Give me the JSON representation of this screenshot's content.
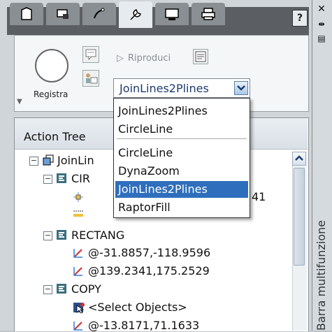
{
  "sidebar": {
    "close_icon": "close-icon",
    "pin_icon": "pin-icon",
    "menu_icon": "menu-icon",
    "vertical_title": "Barra multifunzione"
  },
  "tabs": [
    {
      "icon": "home-icon"
    },
    {
      "icon": "insert-icon"
    },
    {
      "icon": "annotate-icon"
    },
    {
      "icon": "tools-icon",
      "active": true
    },
    {
      "icon": "view-icon"
    },
    {
      "icon": "print-icon"
    }
  ],
  "help_label": "?",
  "ribbon": {
    "record_label": "Registra",
    "play_label": "Riproduci",
    "macro_combo_value": "JoinLines2Plines"
  },
  "dropdown": {
    "items": [
      "JoinLines2Plines",
      "CircleLine",
      "CircleLine",
      "DynaZoom",
      "JoinLines2Plines",
      "RaptorFill"
    ],
    "selected_index": 4
  },
  "tree": {
    "title": "Action Tree",
    "root": "JoinLin",
    "nodes": {
      "cir_label": "CIR",
      "cir_value_tail": "41",
      "rectang_label": "RECTANG",
      "rect_pt1": "@-31.8857,-118.9596",
      "rect_pt2": "@139.2341,175.2529",
      "copy_label": "COPY",
      "select_objects": "<Select Objects>",
      "copy_pt": "@-13.8171,71.1633"
    }
  },
  "colors": {
    "selection": "#2f6ebc",
    "tab_strip": "#5b5f63"
  }
}
